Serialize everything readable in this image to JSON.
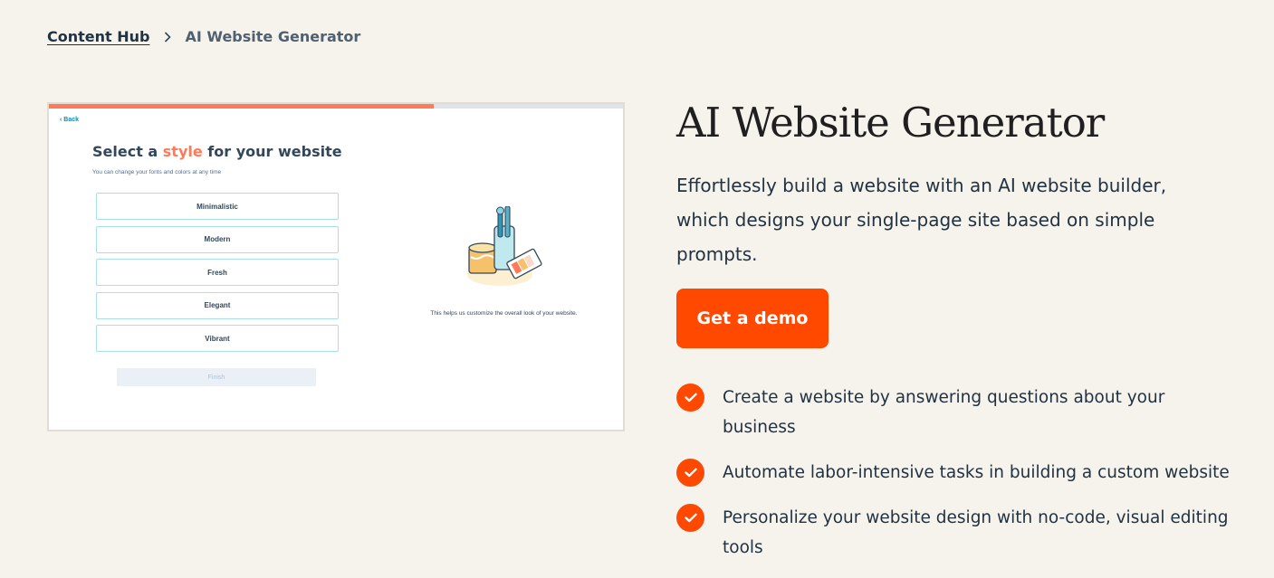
{
  "breadcrumb": {
    "parent": "Content Hub",
    "current": "AI Website Generator"
  },
  "screenshot": {
    "progress_fraction": 0.67,
    "back_label": "‹ Back",
    "title_prefix": "Select a ",
    "title_highlight": "style",
    "title_suffix": " for your website",
    "subtitle": "You can change your fonts and colors at any time",
    "options": [
      "Minimalistic",
      "Modern",
      "Fresh",
      "Elegant",
      "Vibrant"
    ],
    "finish_label": "Finish",
    "caption": "This helps us customize the overall look of your website."
  },
  "hero": {
    "title": "AI Website Generator",
    "description": "Effortlessly build a website with an AI website builder, which designs your single-page site based on simple prompts.",
    "cta_label": "Get a demo"
  },
  "features": [
    "Create a website by answering questions about your business",
    "Automate labor-intensive tasks in building a custom website",
    "Personalize your website design with no-code, visual editing tools"
  ],
  "colors": {
    "background": "#f6f3ed",
    "accent": "#ff4800",
    "highlight": "#ff7a59",
    "text": "#213343"
  },
  "icons": {
    "breadcrumb_separator": "chevron-right-icon",
    "feature_bullet": "checkmark-icon",
    "illustration": "paint-supplies-illustration"
  }
}
